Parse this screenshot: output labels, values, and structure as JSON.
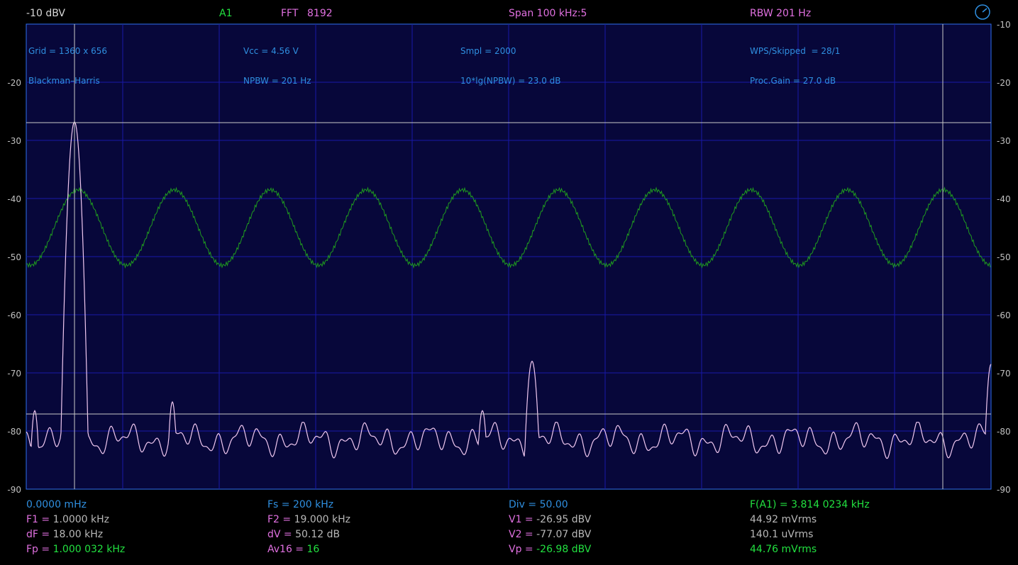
{
  "header": {
    "ref_level": "-10 dBV",
    "channel": "A1",
    "fft_label": "FFT",
    "fft_size": "8192",
    "span": "Span 100 kHz:5",
    "rbw": "RBW 201 Hz"
  },
  "info": {
    "col1": [
      "Grid = 1360 x 656",
      "Blackman–Harris"
    ],
    "col2": [
      "Vcc = 4.56 V",
      "NPBW = 201 Hz"
    ],
    "col3": [
      "Smpl = 2000",
      "10*lg(NPBW) = 23.0 dB"
    ],
    "col4": [
      "WPS/Skipped  = 28/1",
      "Proc.Gain = 27.0 dB"
    ]
  },
  "y_axis": {
    "left_labels": [
      "-20",
      "-30",
      "-40",
      "-50",
      "-60",
      "-70",
      "-80",
      "-90"
    ],
    "right_labels": [
      "-10",
      "-20",
      "-30",
      "-40",
      "-50",
      "-60",
      "-70",
      "-80",
      "-90"
    ]
  },
  "footer": {
    "c1": {
      "r0": "0.0000 mHz",
      "r1_lbl": "F1 = ",
      "r1_val": "1.0000 kHz",
      "r2_lbl": "dF = ",
      "r2_val": "18.00 kHz",
      "r3_lbl": "Fp = ",
      "r3_val": "1.000 032 kHz"
    },
    "c2": {
      "r0": "Fs = 200 kHz",
      "r1_lbl": "F2 = ",
      "r1_val": "19.000 kHz",
      "r2_lbl": "dV = ",
      "r2_val": "50.12 dB",
      "r3_lbl": "Av16 = ",
      "r3_val": "16"
    },
    "c3": {
      "r0": "Div = 50.00",
      "r1_lbl": "V1 = ",
      "r1_val": "-26.95 dBV",
      "r2_lbl": "V2 = ",
      "r2_val": "-77.07 dBV",
      "r3_lbl": "Vp = ",
      "r3_val": "-26.98 dBV"
    },
    "c4": {
      "r0": "F(A1) = 3.814 0234 kHz",
      "r1": "44.92 mVrms",
      "r2": "140.1 uVrms",
      "r3": "44.76 mVrms"
    }
  },
  "colors": {
    "background": "#000000",
    "plot_bg": "#07073a",
    "grid": "#1818a8",
    "spectrum": "#f0c8f0",
    "waveform": "#1f9a1f",
    "cursor": "#c8c8c8",
    "accent_green": "#22e040",
    "accent_blue": "#2f8fe0",
    "label_pink": "#e070e0"
  },
  "icons": {
    "settings": "gauge-icon"
  }
}
